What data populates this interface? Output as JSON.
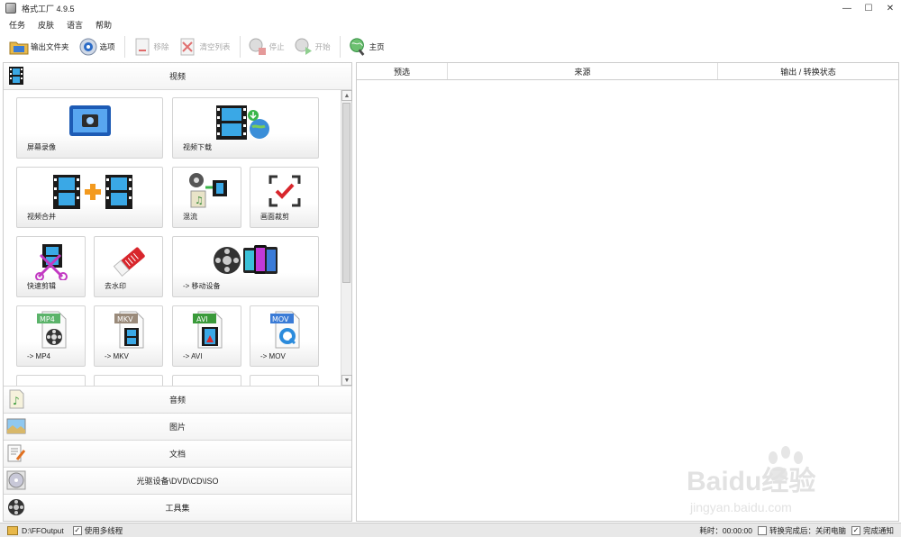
{
  "window": {
    "title": "格式工厂 4.9.5",
    "minimize": "—",
    "maximize": "☐",
    "close": "✕"
  },
  "menu": [
    "任务",
    "皮肤",
    "语言",
    "帮助"
  ],
  "toolbar": {
    "output_folder": "输出文件夹",
    "options": "选项",
    "remove": "移除",
    "clear_list": "清空列表",
    "stop": "停止",
    "start": "开始",
    "home": "主页"
  },
  "left": {
    "video_header": "视频",
    "tiles": [
      {
        "label": "屏幕录像",
        "icon": "screen-record-icon"
      },
      {
        "label": "视频下载",
        "icon": "video-download-icon"
      },
      {
        "label": "视频合并",
        "icon": "video-merge-icon"
      },
      {
        "label": "混流",
        "icon": "mux-icon"
      },
      {
        "label": "画面裁剪",
        "icon": "crop-icon"
      },
      {
        "label": "快速剪辑",
        "icon": "quick-clip-icon"
      },
      {
        "label": "去水印",
        "icon": "remove-watermark-icon"
      },
      {
        "label": "-> 移动设备",
        "icon": "mobile-device-icon"
      },
      {
        "label": "-> MP4",
        "icon": "mp4-file-icon",
        "badge": "MP4"
      },
      {
        "label": "-> MKV",
        "icon": "mkv-file-icon",
        "badge": "MKV"
      },
      {
        "label": "-> AVI",
        "icon": "avi-file-icon",
        "badge": "AVI"
      },
      {
        "label": "-> MOV",
        "icon": "mov-file-icon",
        "badge": "MOV"
      }
    ],
    "categories": [
      {
        "label": "音频",
        "icon": "audio-icon"
      },
      {
        "label": "图片",
        "icon": "picture-icon"
      },
      {
        "label": "文档",
        "icon": "document-icon"
      },
      {
        "label": "光驱设备\\DVD\\CD\\ISO",
        "icon": "disc-icon"
      },
      {
        "label": "工具集",
        "icon": "toolbox-icon"
      }
    ]
  },
  "right": {
    "columns": [
      "预选",
      "来源",
      "输出 / 转换状态"
    ]
  },
  "status": {
    "output_path": "D:\\FFOutput",
    "multithread_label": "使用多线程",
    "multithread_checked": "✓",
    "elapsed": "耗时：00:00:00",
    "after_convert": "转换完成后：关闭电脑",
    "notify": "完成通知",
    "notify_checked": "✓"
  },
  "watermark": {
    "text": "Baidu经验",
    "url": "jingyan.baidu.com"
  },
  "colors": {
    "accent": "#2b7bd6",
    "film": "#1a1a1a",
    "orange": "#f39a1e",
    "red": "#d8262c"
  }
}
